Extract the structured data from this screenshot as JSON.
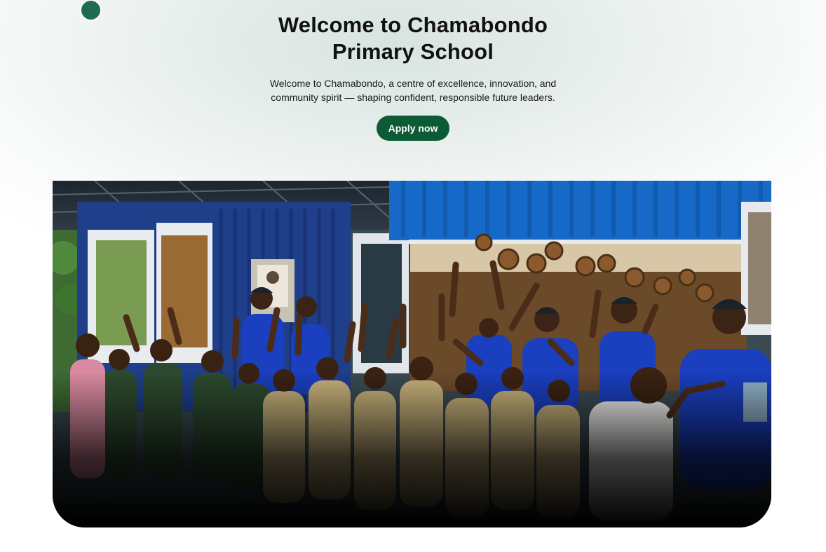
{
  "hero": {
    "title": "Welcome to Chamabondo Primary School",
    "subtitle": "Welcome to Chamabondo, a centre of excellence, innovation, and community spirit — shaping confident, responsible future leaders.",
    "apply_label": "Apply now"
  },
  "colors": {
    "accent": "#0d5a36",
    "dot": "#1e6b4f"
  }
}
